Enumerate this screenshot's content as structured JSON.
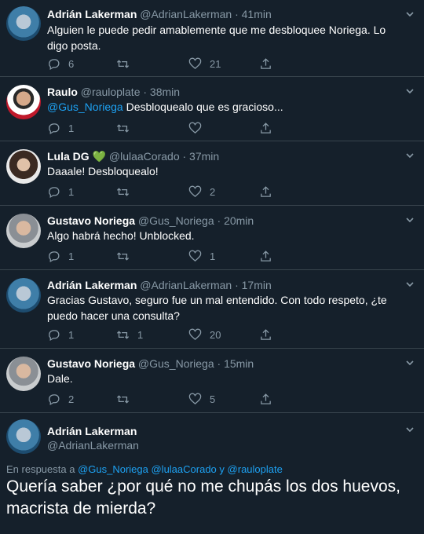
{
  "tweets": [
    {
      "name": "Adrián Lakerman",
      "handle": "@AdrianLakerman",
      "time": "· 41min",
      "text_prefix": "",
      "text": "Alguien le puede pedir amablemente que me desbloquee Noriega. Lo digo posta.",
      "replies": "6",
      "retweets": "",
      "likes": "21",
      "avatar": "adrian"
    },
    {
      "name": "Raulo",
      "handle": "@rauloplate",
      "time": "· 38min",
      "text_prefix": "@Gus_Noriega",
      "text": " Desbloquealo que es gracioso...",
      "replies": "1",
      "retweets": "",
      "likes": "",
      "avatar": "raulo"
    },
    {
      "name": "Lula DG",
      "handle": "@lulaaCorado",
      "time": "· 37min",
      "text_prefix": "",
      "text": "Daaale! Desbloquealo!",
      "replies": "1",
      "retweets": "",
      "likes": "2",
      "avatar": "lula",
      "name_badge": "green-heart-icon"
    },
    {
      "name": "Gustavo Noriega",
      "handle": "@Gus_Noriega",
      "time": "· 20min",
      "text_prefix": "",
      "text": "Algo habrá hecho! Unblocked.",
      "replies": "1",
      "retweets": "",
      "likes": "1",
      "avatar": "gustavo"
    },
    {
      "name": "Adrián Lakerman",
      "handle": "@AdrianLakerman",
      "time": "· 17min",
      "text_prefix": "",
      "text": "Gracias Gustavo, seguro fue un mal entendido. Con todo respeto, ¿te puedo hacer una consulta?",
      "replies": "1",
      "retweets": "1",
      "likes": "20",
      "avatar": "adrian"
    },
    {
      "name": "Gustavo Noriega",
      "handle": "@Gus_Noriega",
      "time": "· 15min",
      "text_prefix": "",
      "text": "Dale.",
      "replies": "2",
      "retweets": "",
      "likes": "5",
      "avatar": "gustavo"
    }
  ],
  "main": {
    "name": "Adrián Lakerman",
    "handle": "@AdrianLakerman",
    "reply_label": "En respuesta a",
    "reply_mentions": "@Gus_Noriega @lulaaCorado",
    "reply_and": "y",
    "reply_last": "@rauloplate",
    "text": "Quería saber ¿por qué no me chupás los dos huevos, macrista de mierda?"
  },
  "colors": {
    "background": "#15202b",
    "accent": "#1da1f2",
    "muted": "#8899a6",
    "divider": "#38444d"
  }
}
